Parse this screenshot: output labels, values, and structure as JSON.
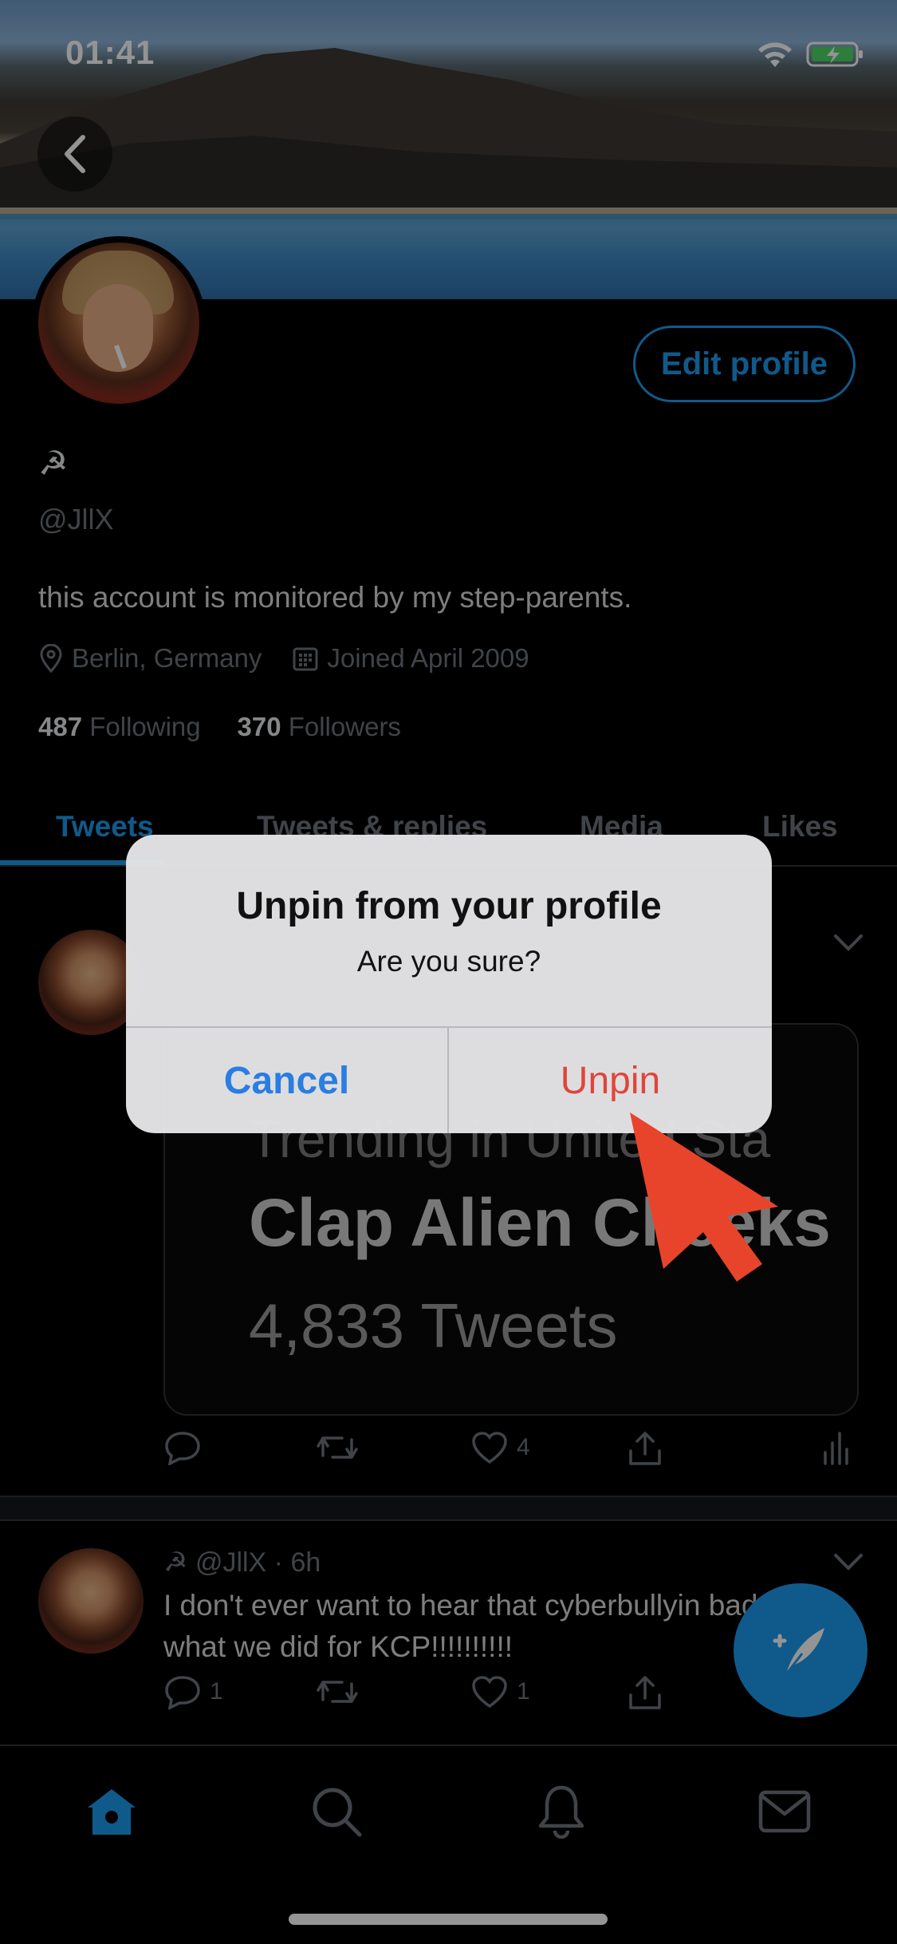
{
  "status_bar": {
    "time": "01:41"
  },
  "profile": {
    "edit_button": "Edit profile",
    "display_name": "☭",
    "handle": "@JllX",
    "bio": "this account is monitored by my step-parents.",
    "location": "Berlin, Germany",
    "joined": "Joined April 2009",
    "following_count": "487",
    "following_label": "Following",
    "followers_count": "370",
    "followers_label": "Followers"
  },
  "tabs": [
    {
      "label": "Tweets",
      "active": true
    },
    {
      "label": "Tweets & replies",
      "active": false
    },
    {
      "label": "Media",
      "active": false
    },
    {
      "label": "Likes",
      "active": false
    }
  ],
  "pinned_tweet": {
    "card_line1": "Trending in United Sta",
    "card_line2": "Clap Alien Cheeks",
    "card_line3": "4,833 Tweets",
    "like_count": "4"
  },
  "tweet2": {
    "name": "☭",
    "handle_time": "@JllX · 6h",
    "text": "I don't ever want to hear that cyberbullyin bad. Look what we did for KCP!!!!!!!!!!",
    "reply_count": "1",
    "like_count": "1"
  },
  "dialog": {
    "title": "Unpin from your profile",
    "message": "Are you sure?",
    "cancel_label": "Cancel",
    "confirm_label": "Unpin"
  },
  "colors": {
    "accent": "#1d9bf0",
    "destructive": "#e0453a",
    "pointer_arrow": "#e8442b"
  }
}
